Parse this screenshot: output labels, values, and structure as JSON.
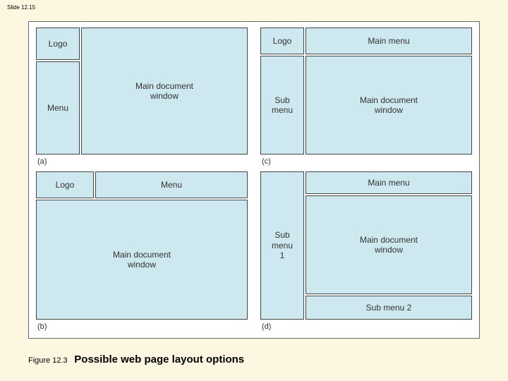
{
  "slide_number": "Slide 12.15",
  "caption": {
    "fignum": "Figure 12.3",
    "title": "Possible web page layout options"
  },
  "labels": {
    "logo": "Logo",
    "menu": "Menu",
    "main": "Main document\nwindow",
    "mainmenu": "Main menu",
    "submenu": "Sub\nmenu",
    "submenu1": "Sub\nmenu\n1",
    "submenu2": "Sub menu 2"
  },
  "letters": {
    "a": "(a)",
    "b": "(b)",
    "c": "(c)",
    "d": "(d)"
  }
}
